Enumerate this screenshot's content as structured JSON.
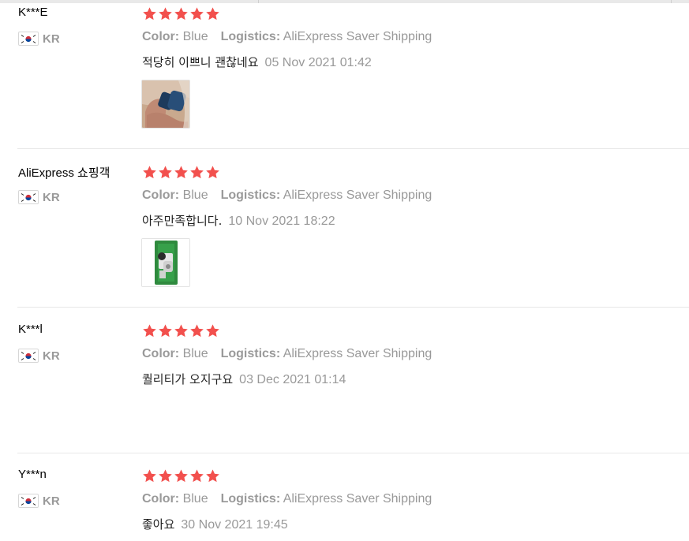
{
  "reviews": [
    {
      "user": "K***E",
      "country": "KR",
      "flag_icon": "south-korea-flag-icon",
      "stars": 5,
      "color_label": "Color:",
      "color_value": "Blue",
      "logistics_label": "Logistics:",
      "logistics_value": "AliExpress Saver Shipping",
      "text": "적당히 이쁘니 괜찮네요",
      "date": "05 Nov 2021 01:42",
      "has_photo": true
    },
    {
      "user": "AliExpress 쇼핑객",
      "country": "KR",
      "flag_icon": "south-korea-flag-icon",
      "stars": 5,
      "color_label": "Color:",
      "color_value": "Blue",
      "logistics_label": "Logistics:",
      "logistics_value": "AliExpress Saver Shipping",
      "text": "아주만족합니다.",
      "date": "10 Nov 2021 18:22",
      "has_photo": true
    },
    {
      "user": "K***l",
      "country": "KR",
      "flag_icon": "south-korea-flag-icon",
      "stars": 5,
      "color_label": "Color:",
      "color_value": "Blue",
      "logistics_label": "Logistics:",
      "logistics_value": "AliExpress Saver Shipping",
      "text": "퀄리티가 오지구요",
      "date": "03 Dec 2021 01:14",
      "has_photo": false
    },
    {
      "user": "Y***n",
      "country": "KR",
      "flag_icon": "south-korea-flag-icon",
      "stars": 5,
      "color_label": "Color:",
      "color_value": "Blue",
      "logistics_label": "Logistics:",
      "logistics_value": "AliExpress Saver Shipping",
      "text": "좋아요",
      "date": "30 Nov 2021 19:45",
      "has_photo": false
    }
  ],
  "colors": {
    "star": "#f2504d",
    "meta_text": "#999999",
    "divider": "#e8e8e8"
  }
}
